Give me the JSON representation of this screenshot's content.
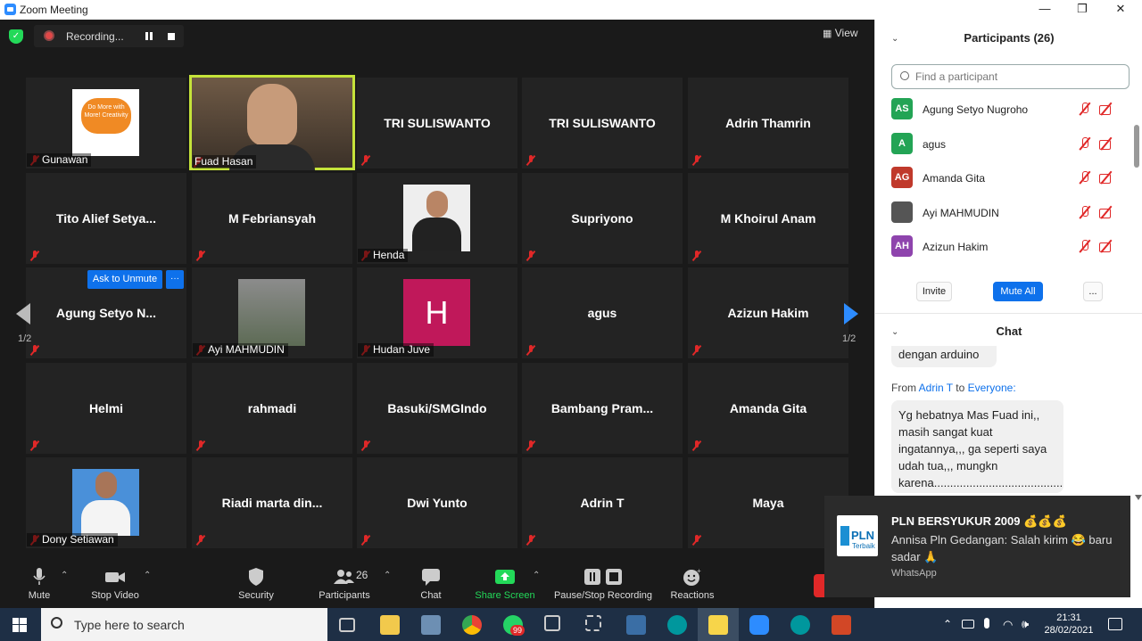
{
  "window": {
    "title": "Zoom Meeting",
    "minimize": "—",
    "restore": "❐",
    "close": "✕"
  },
  "meeting": {
    "recording_label": "Recording...",
    "view_label": "View",
    "page_indicator_left": "1/2",
    "page_indicator_right": "1/2",
    "ask_to_unmute": "Ask to Unmute",
    "more_dots": "···",
    "tiles": [
      {
        "name": "",
        "label": "Gunawan",
        "photo_text": "Do More with More! Creativity"
      },
      {
        "name": "",
        "label": "Fuad Hasan"
      },
      {
        "name": "TRI SULISWANTO",
        "label": ""
      },
      {
        "name": "TRI SULISWANTO",
        "label": ""
      },
      {
        "name": "Adrin Thamrin",
        "label": ""
      },
      {
        "name": "Tito Alief Setya...",
        "label": ""
      },
      {
        "name": "M Febriansyah",
        "label": ""
      },
      {
        "name": "",
        "label": "Henda"
      },
      {
        "name": "Supriyono",
        "label": ""
      },
      {
        "name": "M Khoirul Anam",
        "label": ""
      },
      {
        "name": "Agung Setyo N...",
        "label": ""
      },
      {
        "name": "",
        "label": "Ayi MAHMUDIN"
      },
      {
        "name": "",
        "label": "Hudan Juve",
        "initial": "H"
      },
      {
        "name": "agus",
        "label": ""
      },
      {
        "name": "Azizun Hakim",
        "label": ""
      },
      {
        "name": "Helmi",
        "label": ""
      },
      {
        "name": "rahmadi",
        "label": ""
      },
      {
        "name": "Basuki/SMGIndo",
        "label": ""
      },
      {
        "name": "Bambang Pram...",
        "label": ""
      },
      {
        "name": "Amanda Gita",
        "label": ""
      },
      {
        "name": "",
        "label": "Dony Setiawan"
      },
      {
        "name": "Riadi marta din...",
        "label": ""
      },
      {
        "name": "Dwi Yunto",
        "label": ""
      },
      {
        "name": "Adrin T",
        "label": ""
      },
      {
        "name": "Maya",
        "label": ""
      }
    ]
  },
  "toolbar": {
    "mute": "Mute",
    "stop_video": "Stop Video",
    "security": "Security",
    "participants": "Participants",
    "participants_count": "26",
    "chat": "Chat",
    "share_screen": "Share Screen",
    "pause_stop_recording": "Pause/Stop Recording",
    "reactions": "Reactions"
  },
  "participants_panel": {
    "title": "Participants (26)",
    "search_placeholder": "Find a participant",
    "rows": [
      {
        "initials": "AS",
        "name": "Agung Setyo Nugroho",
        "color": "#23a455"
      },
      {
        "initials": "A",
        "name": "agus",
        "color": "#23a455"
      },
      {
        "initials": "AG",
        "name": "Amanda Gita",
        "color": "#c0392b"
      },
      {
        "initials": "",
        "name": "Ayi MAHMUDIN",
        "color": "#555555"
      },
      {
        "initials": "AH",
        "name": "Azizun Hakim",
        "color": "#8e44ad"
      }
    ],
    "invite": "Invite",
    "mute_all": "Mute All",
    "more": "..."
  },
  "chat_panel": {
    "title": "Chat",
    "prev_message_tail": "dengan arduino",
    "from_prefix": "From",
    "from_name": "Adrin T",
    "to_word": "to",
    "to_name": "Everyone:",
    "message": "Yg hebatnya Mas Fuad ini,, masih sangat kuat ingatannya,,, ga seperti saya udah tua,,, mungkn karena..........................................."
  },
  "notification": {
    "title": "PLN BERSYUKUR 2009 💰💰💰",
    "body": "Annisa Pln Gedangan: Salah kirim 😂 baru sadar 🙏",
    "app": "WhatsApp",
    "logo_text": "PLN",
    "logo_sub": "Terbaik"
  },
  "taskbar": {
    "search_placeholder": "Type here to search",
    "whatsapp_badge": "99",
    "time": "21:31",
    "date": "28/02/2021"
  },
  "colors": {
    "accent": "#2d8cff",
    "active_speaker": "#c5e33a",
    "muted": "#e02828"
  }
}
